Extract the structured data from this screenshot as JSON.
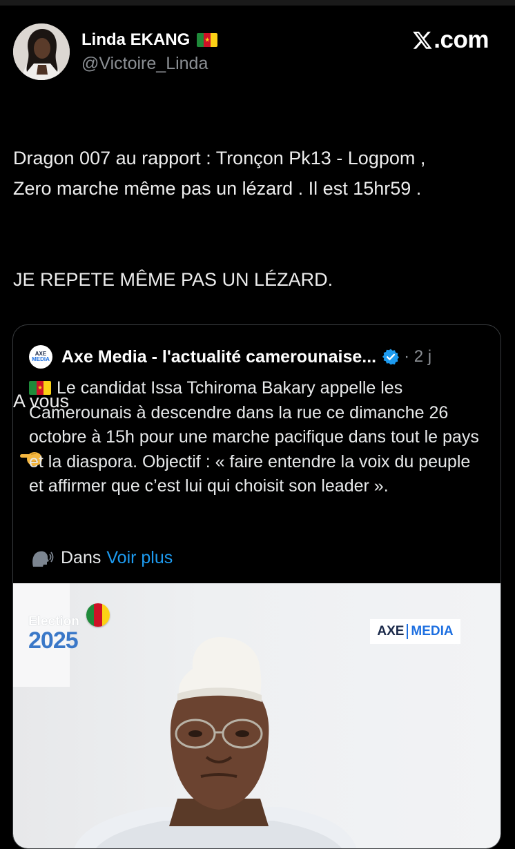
{
  "header": {
    "display_name": "Linda EKANG",
    "handle": "@Victoire_Linda",
    "brand": ".com",
    "flag": "cameroon-flag-icon"
  },
  "tweet": {
    "line1": "Dragon 007 au rapport : Tronçon Pk13 - Logpom ,\nZero marche même pas un lézard . Il est 15hr59 .",
    "line2": "JE REPETE MÊME PAS UN LÉZARD.",
    "line3": "A vous"
  },
  "quote": {
    "author": "Axe Media - l'actualité camerounaise...",
    "date": "· 2 j",
    "text": "Le candidat Issa Tchiroma Bakary appelle les Camerounais à descendre dans la rue ce dimanche 26 octobre à 15h pour une marche pacifique dans tout le pays et la diaspora. Objectif : « faire entendre la voix du peuple et affirmer que c’est lui qui choisit son leader ».",
    "more_prefix": "Dans",
    "more_link": "Voir plus",
    "logo_top": "AXE",
    "logo_bottom": "MEDIA"
  },
  "media": {
    "election_label": "Election",
    "election_year": "2025",
    "badge_left": "AXE",
    "badge_right": "MEDIA"
  },
  "colors": {
    "background": "#000000",
    "link": "#1d9bf0",
    "secondary_text": "#8b8f94",
    "verified": "#1d9bf0"
  }
}
